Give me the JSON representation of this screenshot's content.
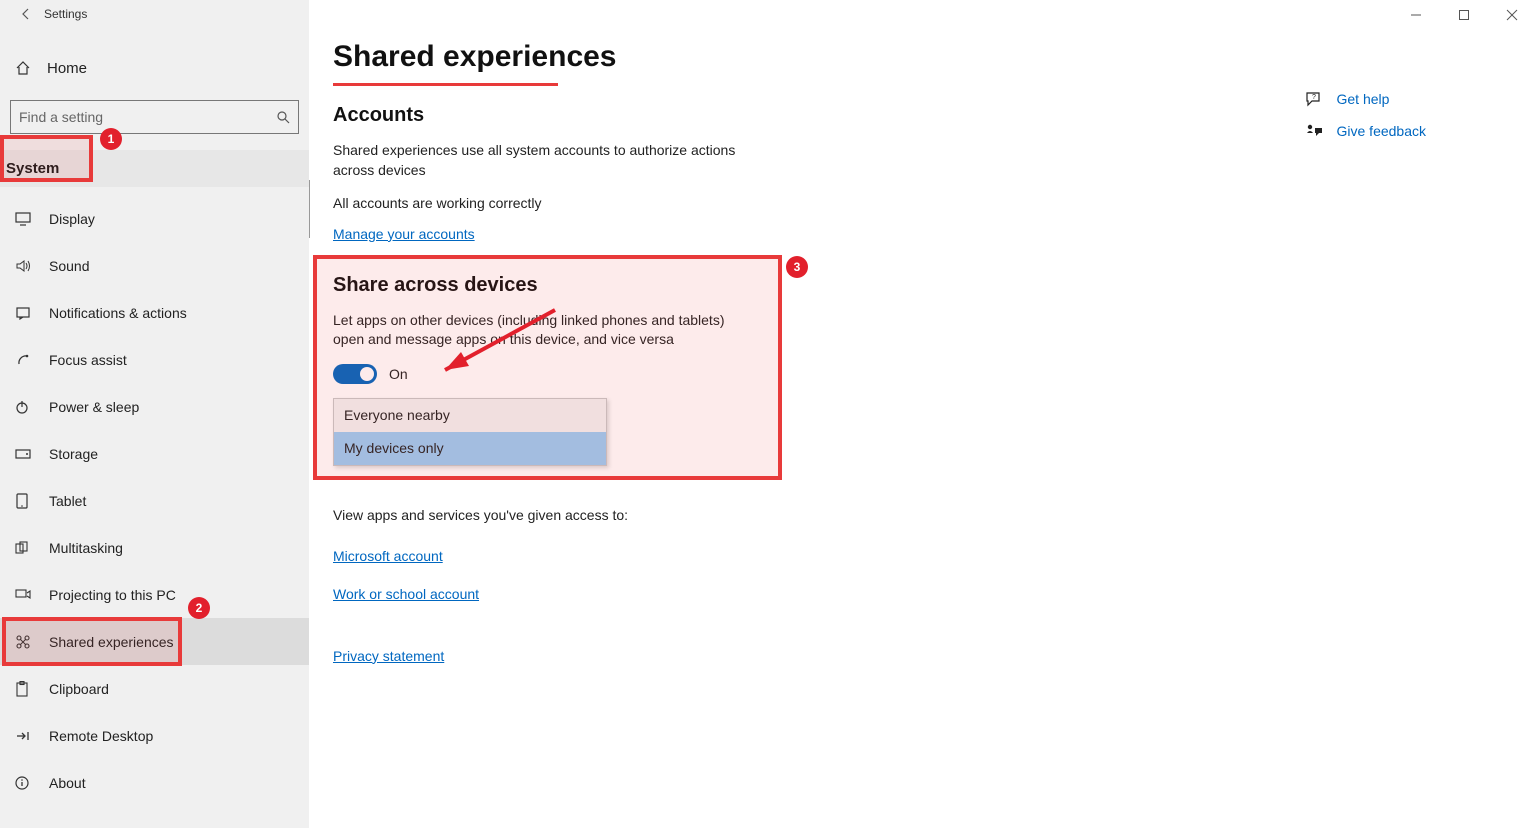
{
  "window": {
    "title": "Settings"
  },
  "sidebar": {
    "home_label": "Home",
    "search_placeholder": "Find a setting",
    "category_label": "System",
    "items": [
      {
        "label": "Display"
      },
      {
        "label": "Sound"
      },
      {
        "label": "Notifications & actions"
      },
      {
        "label": "Focus assist"
      },
      {
        "label": "Power & sleep"
      },
      {
        "label": "Storage"
      },
      {
        "label": "Tablet"
      },
      {
        "label": "Multitasking"
      },
      {
        "label": "Projecting to this PC"
      },
      {
        "label": "Shared experiences"
      },
      {
        "label": "Clipboard"
      },
      {
        "label": "Remote Desktop"
      },
      {
        "label": "About"
      }
    ]
  },
  "page": {
    "title": "Shared experiences",
    "accounts": {
      "heading": "Accounts",
      "desc": "Shared experiences use all system accounts to authorize actions across devices",
      "status": "All accounts are working correctly",
      "manage_link": "Manage your accounts"
    },
    "share": {
      "heading": "Share across devices",
      "desc": "Let apps on other devices (including linked phones and tablets) open and message apps on this device, and vice versa",
      "toggle_state": "On",
      "options": [
        "Everyone nearby",
        "My devices only"
      ],
      "selected_option": "My devices only",
      "view_access": "View apps and services you've given access to:",
      "link_ms": "Microsoft account",
      "link_work": "Work or school account",
      "privacy": "Privacy statement"
    }
  },
  "aside": {
    "help": "Get help",
    "feedback": "Give feedback"
  },
  "annotations": {
    "b1": "1",
    "b2": "2",
    "b3": "3"
  },
  "colors": {
    "accent": "#0067c0",
    "annotation": "#e83a3a"
  }
}
